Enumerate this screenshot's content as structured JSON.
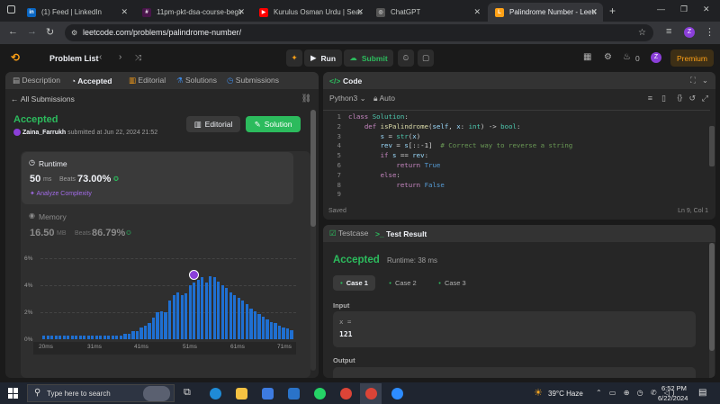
{
  "browser": {
    "tabs": [
      {
        "title": "(1) Feed | LinkedIn",
        "fav": "in",
        "color": "#0a66c2"
      },
      {
        "title": "11pm-pkt-dsa-course-begin",
        "fav": "#",
        "color": "#e01e5a"
      },
      {
        "title": "Kurulus Osman Urdu | Seaso",
        "fav": "▶",
        "color": "#ff0000"
      },
      {
        "title": "ChatGPT",
        "fav": "◎",
        "color": "#444"
      },
      {
        "title": "Palindrome Number - LeetC",
        "fav": "L",
        "color": "#ffa116"
      }
    ],
    "new_tab": "+",
    "url": "leetcode.com/problems/palindrome-number/"
  },
  "header": {
    "problem_list": "Problem List",
    "run": "Run",
    "submit": "Submit",
    "streak": "0",
    "premium": "Premium",
    "avatar": "Z"
  },
  "left": {
    "tabs": [
      "Description",
      "Accepted",
      "Editorial",
      "Solutions",
      "Submissions"
    ],
    "all_submissions": "All Submissions",
    "status": "Accepted",
    "user": "Zaina_Farrukh",
    "submitted": "submitted at Jun 22, 2024 21:52",
    "editorial_btn": "Editorial",
    "solution_btn": "Solution",
    "runtime": {
      "label": "Runtime",
      "value": "50",
      "unit": "ms",
      "beats_label": "Beats",
      "beats": "73.00%",
      "analyze": "Analyze Complexity"
    },
    "memory": {
      "label": "Memory",
      "value": "16.50",
      "unit": "MB",
      "beats_label": "Beats",
      "beats": "86.79%"
    }
  },
  "chart_data": {
    "type": "bar",
    "yticks": [
      "6%",
      "4%",
      "2%",
      "0%"
    ],
    "xticks": [
      "20ms",
      "31ms",
      "41ms",
      "51ms",
      "61ms",
      "71ms"
    ],
    "ylim": [
      0,
      6
    ],
    "values": [
      0.3,
      0.3,
      0.3,
      0.3,
      0.3,
      0.3,
      0.3,
      0.3,
      0.3,
      0.3,
      0.3,
      0.3,
      0.3,
      0.3,
      0.3,
      0.3,
      0.3,
      0.3,
      0.3,
      0.3,
      0.4,
      0.4,
      0.6,
      0.6,
      0.9,
      1.0,
      1.2,
      1.6,
      2.0,
      2.1,
      2.0,
      2.9,
      3.3,
      3.5,
      3.3,
      3.4,
      4.0,
      4.2,
      4.4,
      4.6,
      4.2,
      4.7,
      4.6,
      4.3,
      4.0,
      3.8,
      3.5,
      3.3,
      3.1,
      2.9,
      2.6,
      2.3,
      2.1,
      1.9,
      1.7,
      1.5,
      1.3,
      1.2,
      1.0,
      0.9,
      0.8,
      0.7
    ],
    "marker_index": 37
  },
  "code": {
    "language": "Python3",
    "mode": "Auto",
    "title": "Code",
    "lines": [
      "class Solution:",
      "    def isPalindrome(self, x: int) -> bool:",
      "        s = str(x)",
      "        rev = s[::-1]  # Correct way to reverse a string",
      "        if s == rev:",
      "            return True",
      "        else:",
      "            return False",
      ""
    ],
    "saved": "Saved",
    "cursor": "Ln 9, Col 1"
  },
  "result": {
    "tab_testcase": "Testcase",
    "tab_result": "Test Result",
    "status": "Accepted",
    "runtime": "Runtime: 38 ms",
    "cases": [
      "Case 1",
      "Case 2",
      "Case 3"
    ],
    "input_label": "Input",
    "var": "x =",
    "value": "121",
    "output_label": "Output"
  },
  "taskbar": {
    "search": "Type here to search",
    "weather": "39°C  Haze",
    "time": "6:52 PM",
    "date": "6/22/2024"
  }
}
